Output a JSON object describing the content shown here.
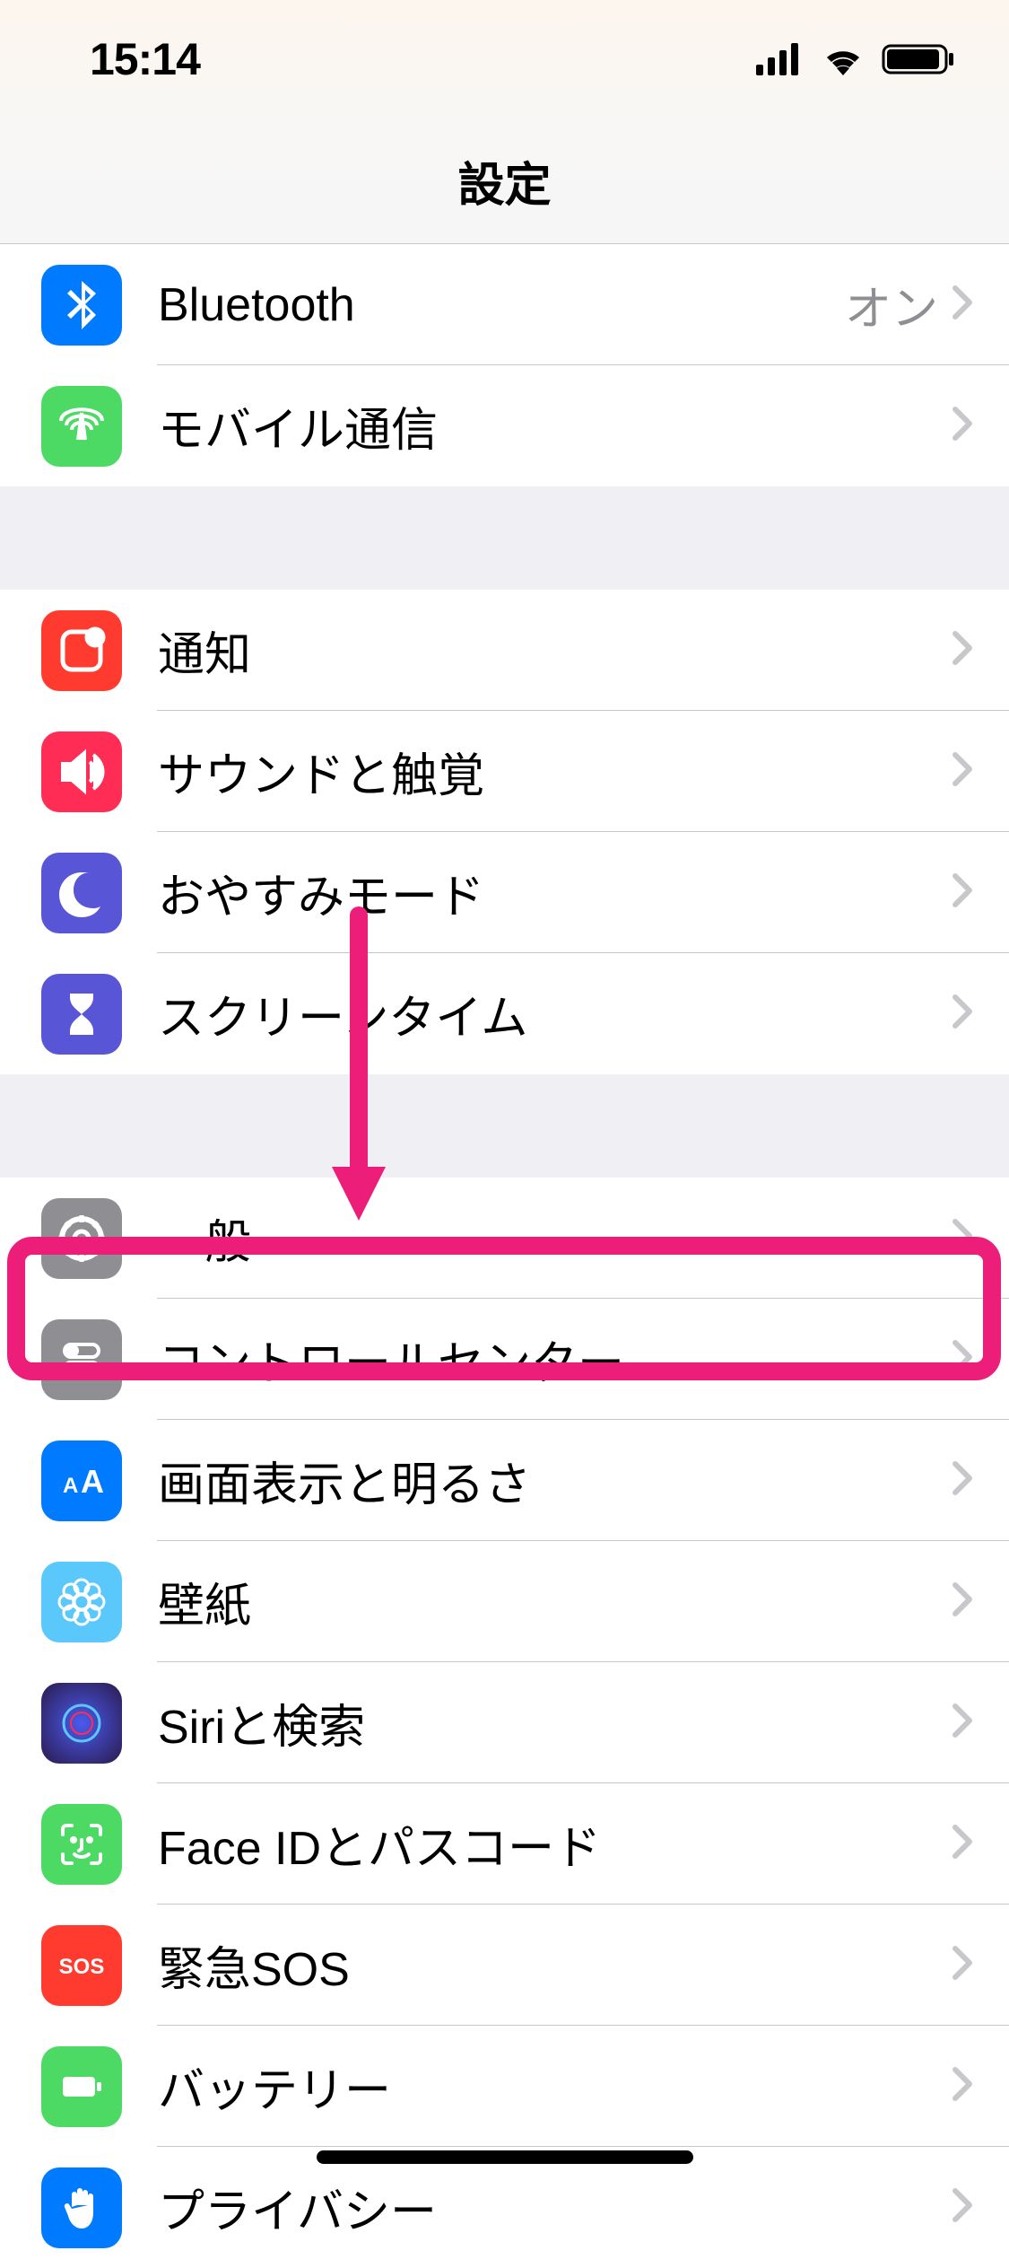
{
  "status": {
    "time": "15:14"
  },
  "header": {
    "title": "設定"
  },
  "sections": [
    {
      "rows": [
        {
          "icon": "bluetooth",
          "bg": "bg-blue",
          "label": "Bluetooth",
          "value": "オン"
        },
        {
          "icon": "cellular",
          "bg": "bg-green",
          "label": "モバイル通信",
          "value": ""
        }
      ]
    },
    {
      "rows": [
        {
          "icon": "notifications",
          "bg": "bg-red",
          "label": "通知",
          "value": ""
        },
        {
          "icon": "sound",
          "bg": "bg-red2",
          "label": "サウンドと触覚",
          "value": ""
        },
        {
          "icon": "moon",
          "bg": "bg-purple",
          "label": "おやすみモード",
          "value": ""
        },
        {
          "icon": "hourglass",
          "bg": "bg-purple",
          "label": "スクリーンタイム",
          "value": ""
        }
      ]
    },
    {
      "rows": [
        {
          "icon": "gear",
          "bg": "bg-gray",
          "label": "一般",
          "value": ""
        },
        {
          "icon": "toggles",
          "bg": "bg-gray",
          "label": "コントロールセンター",
          "value": ""
        },
        {
          "icon": "aa",
          "bg": "bg-blue",
          "label": "画面表示と明るさ",
          "value": ""
        },
        {
          "icon": "flower",
          "bg": "bg-cyan",
          "label": "壁紙",
          "value": ""
        },
        {
          "icon": "siri",
          "bg": "bg-siri",
          "label": "Siriと検索",
          "value": ""
        },
        {
          "icon": "faceid",
          "bg": "bg-faceid",
          "label": "Face IDとパスコード",
          "value": ""
        },
        {
          "icon": "sos",
          "bg": "bg-sos",
          "label": "緊急SOS",
          "value": ""
        },
        {
          "icon": "battery",
          "bg": "bg-battery",
          "label": "バッテリー",
          "value": ""
        },
        {
          "icon": "hand",
          "bg": "bg-privacy",
          "label": "プライバシー",
          "value": ""
        }
      ]
    }
  ]
}
